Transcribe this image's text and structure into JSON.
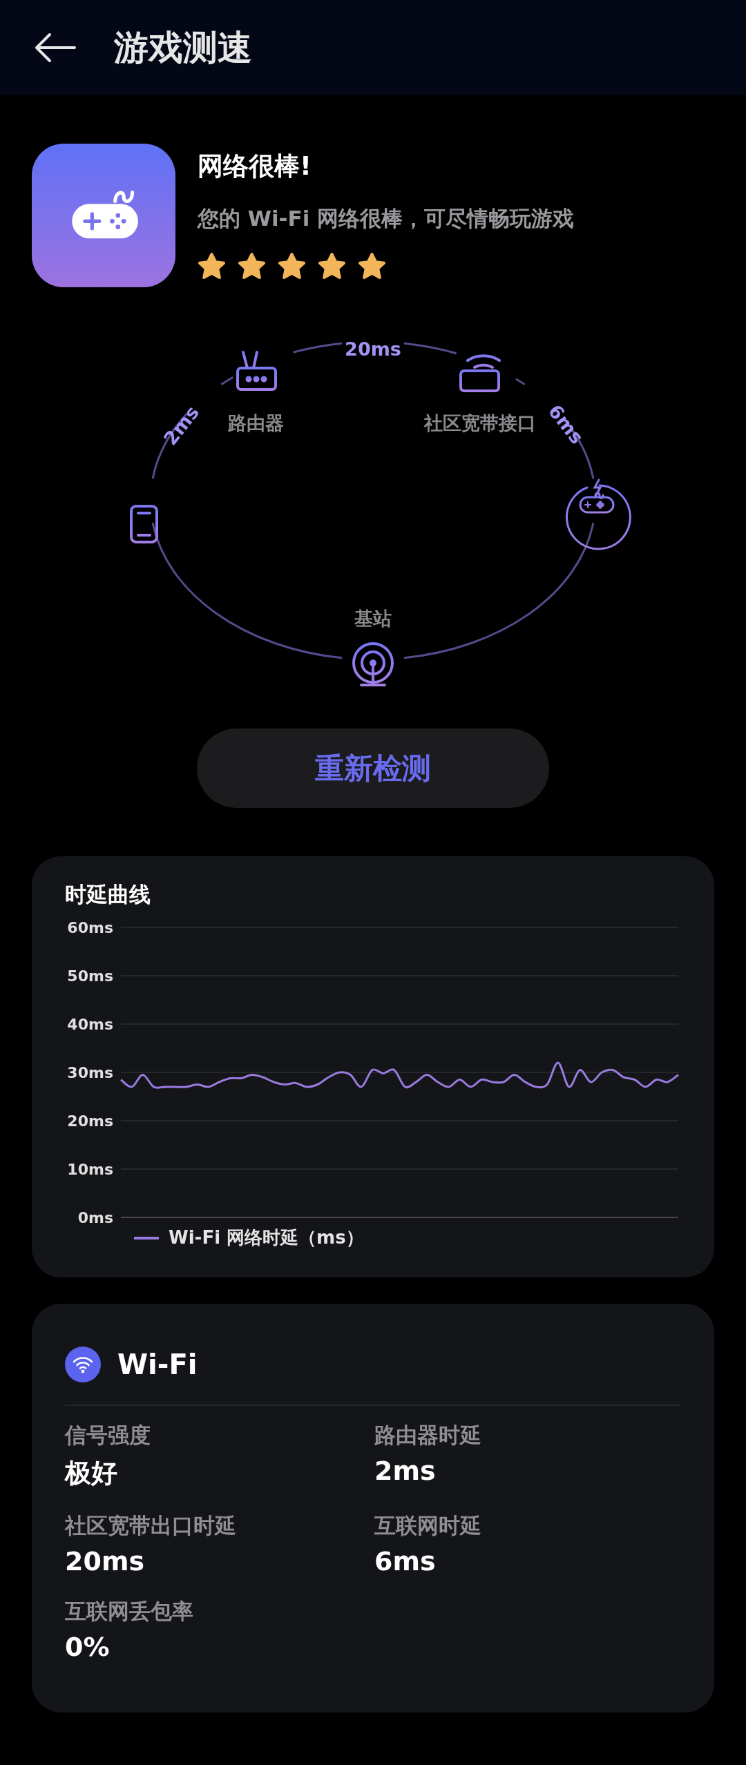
{
  "header": {
    "title": "游戏测速"
  },
  "summary": {
    "title": "网络很棒!",
    "message": "您的 Wi-Fi 网络很棒，可尽情畅玩游戏",
    "stars": 5
  },
  "path": {
    "router_label": "路由器",
    "broadband_label": "社区宽带接口",
    "base_station_label": "基站",
    "links": [
      "2ms",
      "20ms",
      "6ms"
    ]
  },
  "retest_button": "重新检测",
  "latency_chart": {
    "title": "时延曲线",
    "chart_data": {
      "type": "line",
      "grid": true,
      "ylim": [
        0,
        60
      ],
      "yticks": [
        {
          "value": 0,
          "label": "0ms"
        },
        {
          "value": 10,
          "label": "10ms"
        },
        {
          "value": 20,
          "label": "20ms"
        },
        {
          "value": 30,
          "label": "30ms"
        },
        {
          "value": 40,
          "label": "40ms"
        },
        {
          "value": 50,
          "label": "50ms"
        },
        {
          "value": 60,
          "label": "60ms"
        }
      ],
      "series": [
        {
          "name": "Wi-Fi 网络时延（ms）",
          "color": "#9a7be0",
          "values": [
            28.5,
            27,
            29.5,
            27,
            27,
            27,
            27,
            27.5,
            27,
            28,
            28.8,
            28.8,
            29.5,
            29,
            28,
            27.5,
            27.8,
            27,
            27.5,
            29,
            30,
            29.5,
            27,
            30.5,
            29.8,
            30.5,
            27,
            28,
            29.5,
            28,
            27,
            28.5,
            27,
            28.5,
            28,
            28,
            29.5,
            28,
            27,
            27.5,
            32,
            27,
            30.5,
            28,
            30,
            30.5,
            29,
            28.5,
            27,
            28.5,
            28,
            29.5
          ]
        }
      ]
    }
  },
  "wifi": {
    "title": "Wi-Fi",
    "stats": [
      {
        "label": "信号强度",
        "value": "极好"
      },
      {
        "label": "路由器时延",
        "value": "2ms"
      },
      {
        "label": "社区宽带出口时延",
        "value": "20ms"
      },
      {
        "label": "互联网时延",
        "value": "6ms"
      },
      {
        "label": "互联网丢包率",
        "value": "0%"
      }
    ]
  }
}
